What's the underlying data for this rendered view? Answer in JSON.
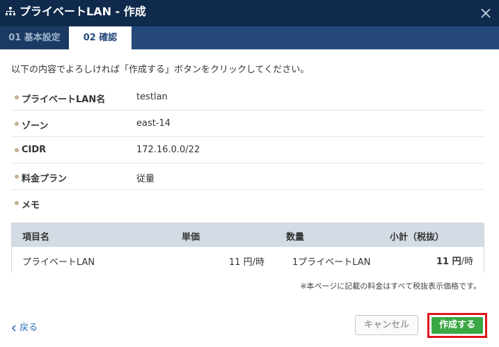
{
  "dialog": {
    "title": "プライベートLAN - 作成",
    "close_icon": "close-icon",
    "title_icon": "network-icon"
  },
  "tabs": [
    {
      "label": "01 基本設定",
      "active": false
    },
    {
      "label": "02 確認",
      "active": true
    }
  ],
  "intro": "以下の内容でよろしければ「作成する」ボタンをクリックしてください。",
  "details": [
    {
      "label": "プライベートLAN名",
      "value": "testlan"
    },
    {
      "label": "ゾーン",
      "value": "east-14"
    },
    {
      "label": "CIDR",
      "value": "172.16.0.0/22"
    },
    {
      "label": "料金プラン",
      "value": "従量"
    },
    {
      "label": "メモ",
      "value": ""
    }
  ],
  "pricing": {
    "headers": {
      "item": "項目名",
      "unit_price": "単価",
      "quantity": "数量",
      "subtotal": "小計（税抜）"
    },
    "row": {
      "item": "プライベートLAN",
      "unit_price": "11 円/時",
      "quantity": "1プライベートLAN",
      "subtotal_amount": "11 円",
      "subtotal_unit": "/時"
    }
  },
  "note": "※本ページに記載の料金はすべて税抜表示価格です。",
  "footer": {
    "back_label": "戻る",
    "cancel_label": "キャンセル",
    "create_label": "作成する"
  },
  "colors": {
    "header_bg": "#0f2a4c",
    "tab_bar_bg": "#24497a",
    "accent_price": "#d4267a",
    "create_button": "#3aa745",
    "highlight_border": "#e0151b",
    "link": "#2f6fbf"
  }
}
